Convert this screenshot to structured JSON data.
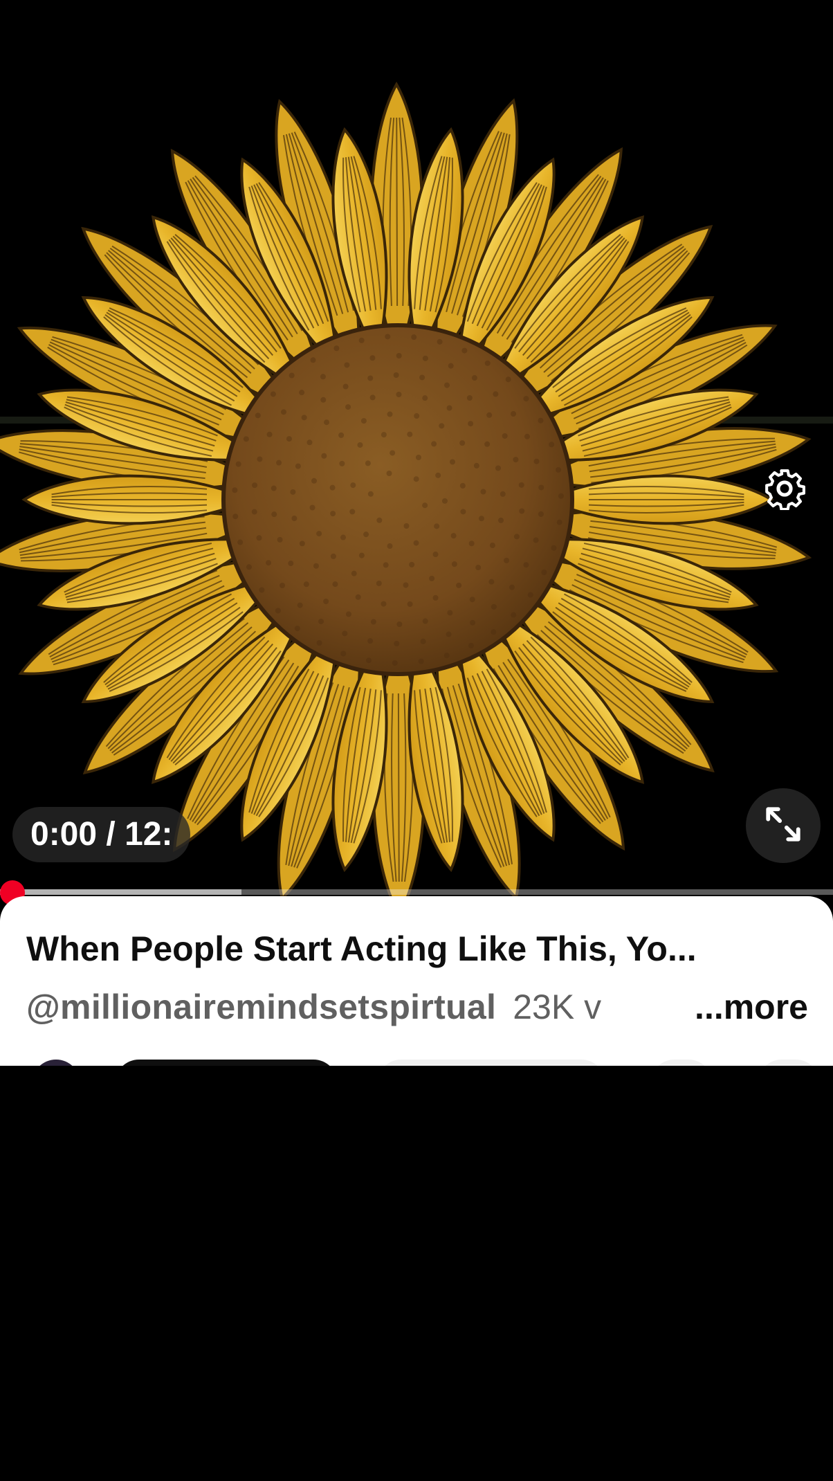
{
  "player": {
    "time_display": "0:00 / 12:",
    "progress": 0.0,
    "buffered": 0.29,
    "settings_icon": "gear-icon",
    "fullscreen_icon": "fullscreen-expand-icon",
    "thumbnail_subject": "sunflower"
  },
  "info": {
    "title": "When People Start Acting Like This, Yo...",
    "channel_handle": "@millionairemindsetspirtual",
    "views": "23K v",
    "more_label": "...more"
  },
  "colors": {
    "scrubber": "#f00024",
    "petal": "#e9b92c",
    "petal_dark": "#c7951a",
    "center": "#7a4f1d",
    "background": "#000000",
    "panel": "#ffffff"
  }
}
